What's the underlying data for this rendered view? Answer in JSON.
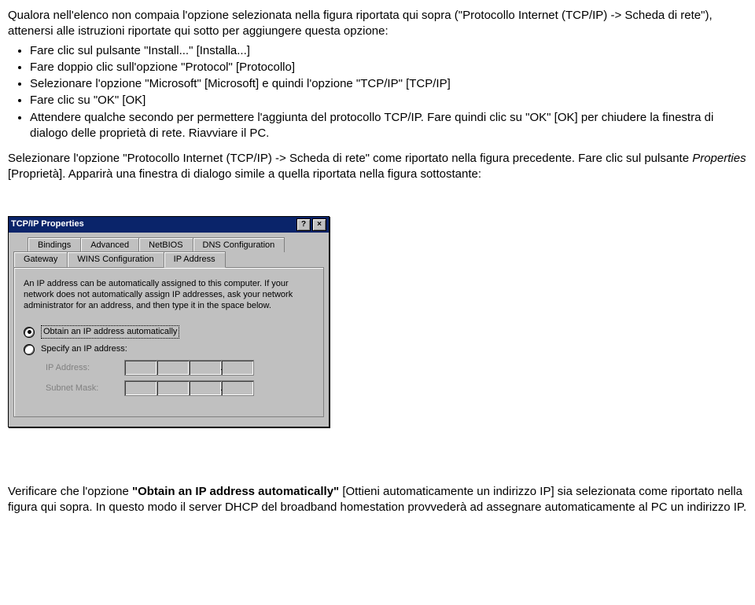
{
  "intro": {
    "p1": "Qualora nell'elenco non compaia l'opzione selezionata nella figura riportata qui sopra (\"Protocollo Internet (TCP/IP) -> Scheda di rete\"), attenersi alle istruzioni riportate qui sotto per aggiungere questa opzione:",
    "bullets": [
      "Fare clic sul pulsante \"Install...\" [Installa...]",
      "Fare doppio clic sull'opzione \"Protocol\" [Protocollo]",
      "Selezionare l'opzione \"Microsoft\" [Microsoft] e quindi l'opzione \"TCP/IP\" [TCP/IP]",
      "Fare clic su \"OK\" [OK]",
      "Attendere qualche secondo per permettere l'aggiunta del protocollo TCP/IP. Fare quindi clic su \"OK\" [OK] per chiudere la finestra di dialogo delle proprietà di rete. Riavviare il PC."
    ]
  },
  "para2a": "Selezionare l'opzione \"Protocollo Internet (TCP/IP) -> Scheda di rete\" come riportato nella figura precedente. Fare clic sul pulsante ",
  "para2b": "Properties",
  "para2c": " [Proprietà]. Apparirà una finestra di dialogo simile a quella riportata nella figura sottostante:",
  "dialog": {
    "title": "TCP/IP Properties",
    "helpBtn": "?",
    "closeBtn": "×",
    "tabs_back": [
      "Bindings",
      "Advanced",
      "NetBIOS",
      "DNS Configuration"
    ],
    "tabs_front": [
      "Gateway",
      "WINS Configuration",
      "IP Address"
    ],
    "active_tab": "IP Address",
    "desc": "An IP address can be automatically assigned to this computer. If your network does not automatically assign IP addresses, ask your network administrator for an address, and then type it in the space below.",
    "radio_auto": "Obtain an IP address automatically",
    "radio_manual": "Specify an IP address:",
    "ip_label": "IP Address:",
    "subnet_label": "Subnet Mask:"
  },
  "verify": {
    "pre": "Verificare che l'opzione ",
    "bold": "\"Obtain an IP address automatically\"",
    "post": " [Ottieni automaticamente un indirizzo IP] sia selezionata come riportato nella figura qui sopra. In questo modo il server DHCP del broadband homestation provvederà ad assegnare automaticamente al PC un indirizzo IP."
  }
}
